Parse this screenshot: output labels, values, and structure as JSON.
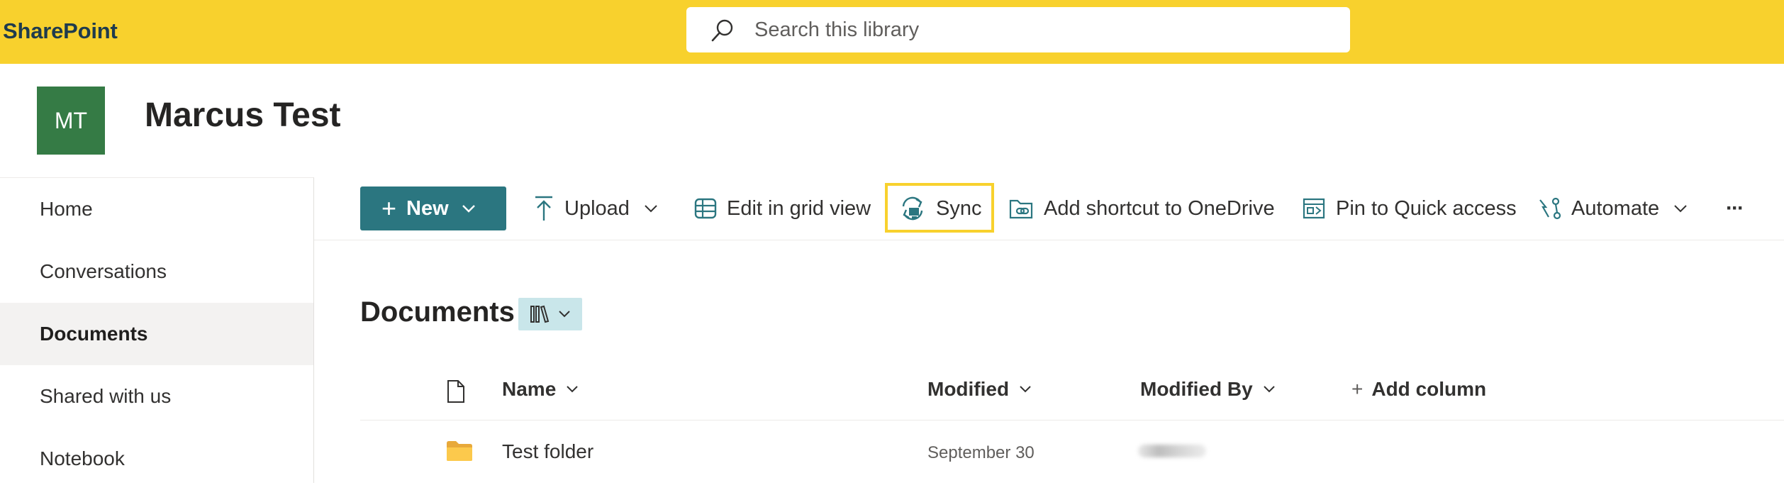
{
  "suite": {
    "brand": "SharePoint",
    "search_placeholder": "Search this library"
  },
  "site": {
    "logo_initials": "MT",
    "title": "Marcus Test",
    "logo_color": "#357b45"
  },
  "nav": {
    "items": [
      {
        "label": "Home",
        "selected": false
      },
      {
        "label": "Conversations",
        "selected": false
      },
      {
        "label": "Documents",
        "selected": true
      },
      {
        "label": "Shared with us",
        "selected": false
      },
      {
        "label": "Notebook",
        "selected": false
      }
    ]
  },
  "command_bar": {
    "new_label": "New",
    "upload_label": "Upload",
    "grid_label": "Edit in grid view",
    "sync_label": "Sync",
    "shortcut_label": "Add shortcut to OneDrive",
    "pin_label": "Pin to Quick access",
    "automate_label": "Automate",
    "more_label": "···",
    "accent_color": "#2b7680",
    "highlight_color": "#f8d12d"
  },
  "library": {
    "title": "Documents",
    "columns": {
      "name": "Name",
      "modified": "Modified",
      "modified_by": "Modified By",
      "add_column": "Add column"
    },
    "rows": [
      {
        "name": "Test folder",
        "type": "folder",
        "modified": "September 30",
        "icon": "folder-icon"
      }
    ]
  },
  "colors": {
    "suite_bar": "#f8d12d",
    "selected_nav": "#f3f2f1"
  }
}
